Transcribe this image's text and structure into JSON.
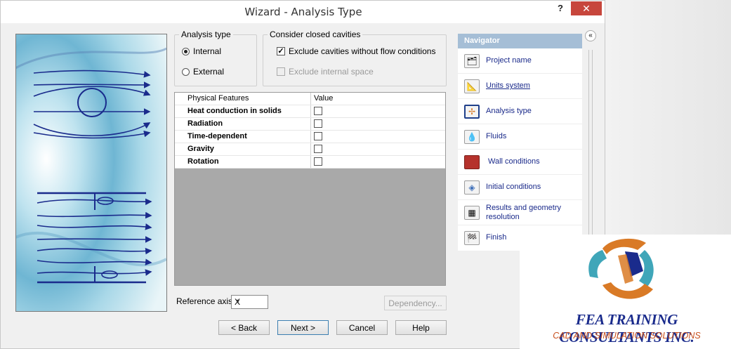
{
  "window": {
    "title": "Wizard - Analysis Type",
    "help_glyph": "?",
    "close_glyph": "✕"
  },
  "analysis_type": {
    "legend": "Analysis type",
    "options": [
      {
        "label": "Internal",
        "selected": true
      },
      {
        "label": "External",
        "selected": false
      }
    ]
  },
  "closed_cavities": {
    "legend": "Consider closed cavities",
    "exclude_no_flow": {
      "label": "Exclude cavities without flow conditions",
      "checked": true
    },
    "exclude_internal": {
      "label": "Exclude internal space",
      "checked": false,
      "disabled": true
    }
  },
  "features_table": {
    "headers": [
      "Physical Features",
      "Value"
    ],
    "rows": [
      {
        "name": "Heat conduction in solids",
        "checked": false
      },
      {
        "name": "Radiation",
        "checked": false
      },
      {
        "name": "Time-dependent",
        "checked": false
      },
      {
        "name": "Gravity",
        "checked": false
      },
      {
        "name": "Rotation",
        "checked": false
      }
    ]
  },
  "reference_axis": {
    "label": "Reference axis:",
    "value": "X"
  },
  "buttons": {
    "dependency": "Dependency...",
    "back": "< Back",
    "next": "Next >",
    "cancel": "Cancel",
    "help": "Help"
  },
  "navigator": {
    "title": "Navigator",
    "collapse_glyph": "«",
    "items": [
      {
        "label": "Project name",
        "icon": "project-name-icon",
        "underline": false,
        "active": false
      },
      {
        "label": "Units system",
        "icon": "units-system-icon",
        "underline": true,
        "active": false
      },
      {
        "label": "Analysis type",
        "icon": "analysis-type-icon",
        "underline": false,
        "active": true
      },
      {
        "label": "Fluids",
        "icon": "fluids-icon",
        "underline": false,
        "active": false
      },
      {
        "label": "Wall conditions",
        "icon": "wall-conditions-icon",
        "underline": false,
        "active": false
      },
      {
        "label": "Initial conditions",
        "icon": "initial-conditions-icon",
        "underline": false,
        "active": false
      },
      {
        "label": "Results and geometry resolution",
        "icon": "grid-icon",
        "underline": false,
        "active": false
      },
      {
        "label": "Finish",
        "icon": "checkered-flag-icon",
        "underline": false,
        "active": false
      }
    ]
  },
  "logo": {
    "company": "FEA TRAINING  CONSULTANTS INC.",
    "tagline": "CAD AND SIMULATION SOLUTIONS",
    "colors": {
      "navy": "#1a2b8c",
      "orange": "#d97a26",
      "teal": "#3fa6b9"
    }
  }
}
